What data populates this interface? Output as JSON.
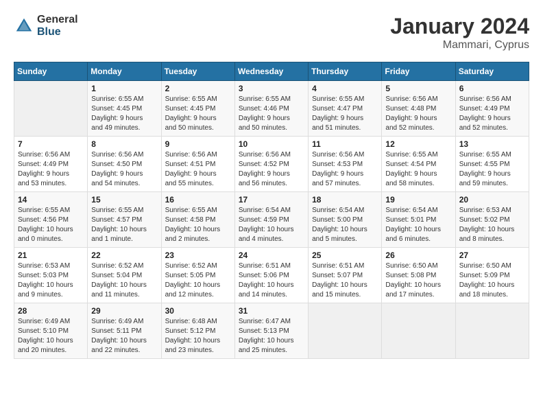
{
  "header": {
    "logo_general": "General",
    "logo_blue": "Blue",
    "title": "January 2024",
    "subtitle": "Mammari, Cyprus"
  },
  "calendar": {
    "days_of_week": [
      "Sunday",
      "Monday",
      "Tuesday",
      "Wednesday",
      "Thursday",
      "Friday",
      "Saturday"
    ],
    "weeks": [
      [
        {
          "day": "",
          "info": ""
        },
        {
          "day": "1",
          "info": "Sunrise: 6:55 AM\nSunset: 4:45 PM\nDaylight: 9 hours\nand 49 minutes."
        },
        {
          "day": "2",
          "info": "Sunrise: 6:55 AM\nSunset: 4:45 PM\nDaylight: 9 hours\nand 50 minutes."
        },
        {
          "day": "3",
          "info": "Sunrise: 6:55 AM\nSunset: 4:46 PM\nDaylight: 9 hours\nand 50 minutes."
        },
        {
          "day": "4",
          "info": "Sunrise: 6:55 AM\nSunset: 4:47 PM\nDaylight: 9 hours\nand 51 minutes."
        },
        {
          "day": "5",
          "info": "Sunrise: 6:56 AM\nSunset: 4:48 PM\nDaylight: 9 hours\nand 52 minutes."
        },
        {
          "day": "6",
          "info": "Sunrise: 6:56 AM\nSunset: 4:49 PM\nDaylight: 9 hours\nand 52 minutes."
        }
      ],
      [
        {
          "day": "7",
          "info": "Sunrise: 6:56 AM\nSunset: 4:49 PM\nDaylight: 9 hours\nand 53 minutes."
        },
        {
          "day": "8",
          "info": "Sunrise: 6:56 AM\nSunset: 4:50 PM\nDaylight: 9 hours\nand 54 minutes."
        },
        {
          "day": "9",
          "info": "Sunrise: 6:56 AM\nSunset: 4:51 PM\nDaylight: 9 hours\nand 55 minutes."
        },
        {
          "day": "10",
          "info": "Sunrise: 6:56 AM\nSunset: 4:52 PM\nDaylight: 9 hours\nand 56 minutes."
        },
        {
          "day": "11",
          "info": "Sunrise: 6:56 AM\nSunset: 4:53 PM\nDaylight: 9 hours\nand 57 minutes."
        },
        {
          "day": "12",
          "info": "Sunrise: 6:55 AM\nSunset: 4:54 PM\nDaylight: 9 hours\nand 58 minutes."
        },
        {
          "day": "13",
          "info": "Sunrise: 6:55 AM\nSunset: 4:55 PM\nDaylight: 9 hours\nand 59 minutes."
        }
      ],
      [
        {
          "day": "14",
          "info": "Sunrise: 6:55 AM\nSunset: 4:56 PM\nDaylight: 10 hours\nand 0 minutes."
        },
        {
          "day": "15",
          "info": "Sunrise: 6:55 AM\nSunset: 4:57 PM\nDaylight: 10 hours\nand 1 minute."
        },
        {
          "day": "16",
          "info": "Sunrise: 6:55 AM\nSunset: 4:58 PM\nDaylight: 10 hours\nand 2 minutes."
        },
        {
          "day": "17",
          "info": "Sunrise: 6:54 AM\nSunset: 4:59 PM\nDaylight: 10 hours\nand 4 minutes."
        },
        {
          "day": "18",
          "info": "Sunrise: 6:54 AM\nSunset: 5:00 PM\nDaylight: 10 hours\nand 5 minutes."
        },
        {
          "day": "19",
          "info": "Sunrise: 6:54 AM\nSunset: 5:01 PM\nDaylight: 10 hours\nand 6 minutes."
        },
        {
          "day": "20",
          "info": "Sunrise: 6:53 AM\nSunset: 5:02 PM\nDaylight: 10 hours\nand 8 minutes."
        }
      ],
      [
        {
          "day": "21",
          "info": "Sunrise: 6:53 AM\nSunset: 5:03 PM\nDaylight: 10 hours\nand 9 minutes."
        },
        {
          "day": "22",
          "info": "Sunrise: 6:52 AM\nSunset: 5:04 PM\nDaylight: 10 hours\nand 11 minutes."
        },
        {
          "day": "23",
          "info": "Sunrise: 6:52 AM\nSunset: 5:05 PM\nDaylight: 10 hours\nand 12 minutes."
        },
        {
          "day": "24",
          "info": "Sunrise: 6:51 AM\nSunset: 5:06 PM\nDaylight: 10 hours\nand 14 minutes."
        },
        {
          "day": "25",
          "info": "Sunrise: 6:51 AM\nSunset: 5:07 PM\nDaylight: 10 hours\nand 15 minutes."
        },
        {
          "day": "26",
          "info": "Sunrise: 6:50 AM\nSunset: 5:08 PM\nDaylight: 10 hours\nand 17 minutes."
        },
        {
          "day": "27",
          "info": "Sunrise: 6:50 AM\nSunset: 5:09 PM\nDaylight: 10 hours\nand 18 minutes."
        }
      ],
      [
        {
          "day": "28",
          "info": "Sunrise: 6:49 AM\nSunset: 5:10 PM\nDaylight: 10 hours\nand 20 minutes."
        },
        {
          "day": "29",
          "info": "Sunrise: 6:49 AM\nSunset: 5:11 PM\nDaylight: 10 hours\nand 22 minutes."
        },
        {
          "day": "30",
          "info": "Sunrise: 6:48 AM\nSunset: 5:12 PM\nDaylight: 10 hours\nand 23 minutes."
        },
        {
          "day": "31",
          "info": "Sunrise: 6:47 AM\nSunset: 5:13 PM\nDaylight: 10 hours\nand 25 minutes."
        },
        {
          "day": "",
          "info": ""
        },
        {
          "day": "",
          "info": ""
        },
        {
          "day": "",
          "info": ""
        }
      ]
    ]
  }
}
